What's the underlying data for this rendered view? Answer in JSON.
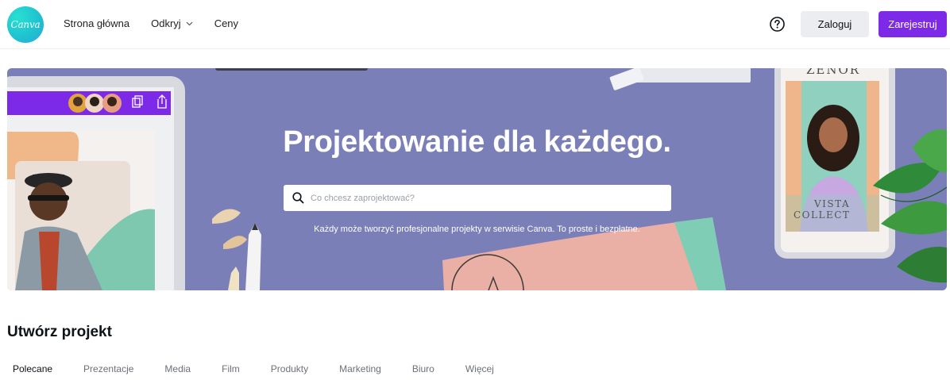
{
  "header": {
    "logo_text": "Canva",
    "nav": [
      {
        "label": "Strona główna"
      },
      {
        "label": "Odkryj"
      },
      {
        "label": "Ceny"
      }
    ],
    "login_label": "Zaloguj",
    "signup_label": "Zarejestruj"
  },
  "hero": {
    "title": "Projektowanie dla każdego.",
    "search_placeholder": "Co chcesz zaprojektować?",
    "subtitle": "Każdy może tworzyć profesjonalne projekty w serwisie Canva. To proste i bezpłatne.",
    "card_text_top": "ZENOR",
    "card_text_1": "VISTA",
    "card_text_2": "COLLECT"
  },
  "create": {
    "title": "Utwórz projekt",
    "tabs": [
      {
        "label": "Polecane",
        "active": true
      },
      {
        "label": "Prezentacje"
      },
      {
        "label": "Media"
      },
      {
        "label": "Film"
      },
      {
        "label": "Produkty"
      },
      {
        "label": "Marketing"
      },
      {
        "label": "Biuro"
      },
      {
        "label": "Więcej"
      }
    ]
  },
  "colors": {
    "brand_purple": "#7d2ae8",
    "hero_bg": "#7b7fb8",
    "logo_teal": "#1fc3cf"
  }
}
